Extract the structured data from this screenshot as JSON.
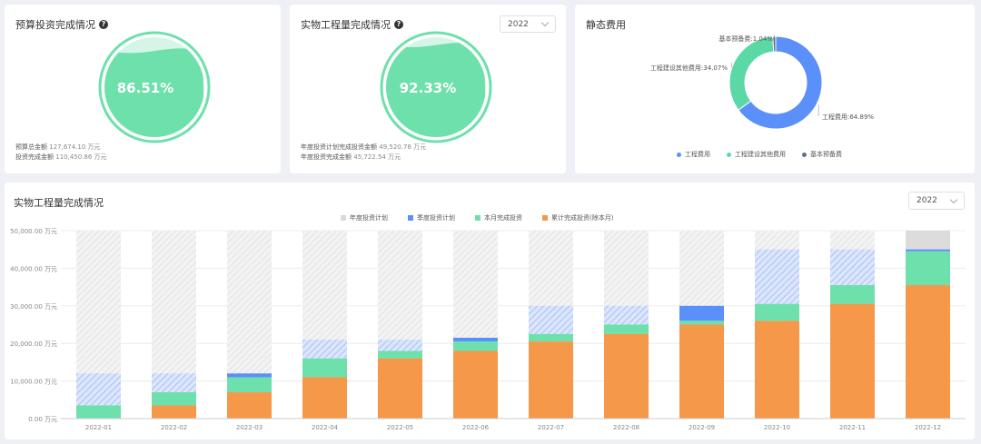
{
  "card1": {
    "title": "预算投资完成情况",
    "percent": "86.51%",
    "fill": 0.8651,
    "line1_label": "预算总金额",
    "line1_value": "127,674.10 万元",
    "line2_label": "投资完成金额",
    "line2_value": "110,450.86 万元"
  },
  "card2": {
    "title": "实物工程量完成情况",
    "year": "2022",
    "percent": "92.33%",
    "fill": 0.9233,
    "line1_label": "年度投资计划完成投资金额",
    "line1_value": "49,520.78 万元",
    "line2_label": "年度投资完成金额",
    "line2_value": "45,722.54 万元"
  },
  "card3": {
    "title": "静态费用",
    "slices": [
      {
        "name": "工程费用",
        "label": "工程费用:64.89%",
        "value": 64.89,
        "color": "#5b8ff9"
      },
      {
        "name": "工程建设其他费用",
        "label": "工程建设其他费用:34.07%",
        "value": 34.07,
        "color": "#5ad8a6"
      },
      {
        "name": "基本预备费",
        "label": "基本预备费:1.04%",
        "value": 1.04,
        "color": "#5d7092"
      }
    ]
  },
  "card4": {
    "title": "实物工程量完成情况",
    "year": "2022",
    "legend": [
      {
        "name": "年度投资计划",
        "color": "#d9d9d9"
      },
      {
        "name": "季度投资计划",
        "color": "#5b8ff9"
      },
      {
        "name": "本月完成投资",
        "color": "#6ee0ac"
      },
      {
        "name": "累计完成投资(除本月)",
        "color": "#f5984a"
      }
    ]
  },
  "chart_data": {
    "type": "bar",
    "categories": [
      "2022-01",
      "2022-02",
      "2022-03",
      "2022-04",
      "2022-05",
      "2022-06",
      "2022-07",
      "2022-08",
      "2022-09",
      "2022-10",
      "2022-11",
      "2022-12"
    ],
    "ylim": [
      0,
      50000
    ],
    "yticks": [
      "0.00 万元",
      "10,000.00 万元",
      "20,000.00 万元",
      "30,000.00 万元",
      "40,000.00 万元",
      "50,000.00 万元"
    ],
    "series": [
      {
        "name": "累计完成投资(除本月)",
        "values": [
          0,
          3500,
          7000,
          11000,
          16000,
          18000,
          20500,
          22500,
          25000,
          26000,
          30500,
          35500
        ]
      },
      {
        "name": "本月完成投资",
        "values": [
          3500,
          3500,
          4000,
          5000,
          2000,
          2500,
          2000,
          2500,
          1000,
          4500,
          5000,
          9000
        ]
      },
      {
        "name": "季度投资计划",
        "values": [
          12000,
          12000,
          12000,
          21000,
          21000,
          21000,
          30000,
          30000,
          30000,
          45000,
          45000,
          45000
        ]
      },
      {
        "name": "年度投资计划",
        "values": [
          50000,
          50000,
          50000,
          50000,
          50000,
          50000,
          50000,
          50000,
          50000,
          50000,
          50000,
          50000
        ]
      }
    ]
  }
}
